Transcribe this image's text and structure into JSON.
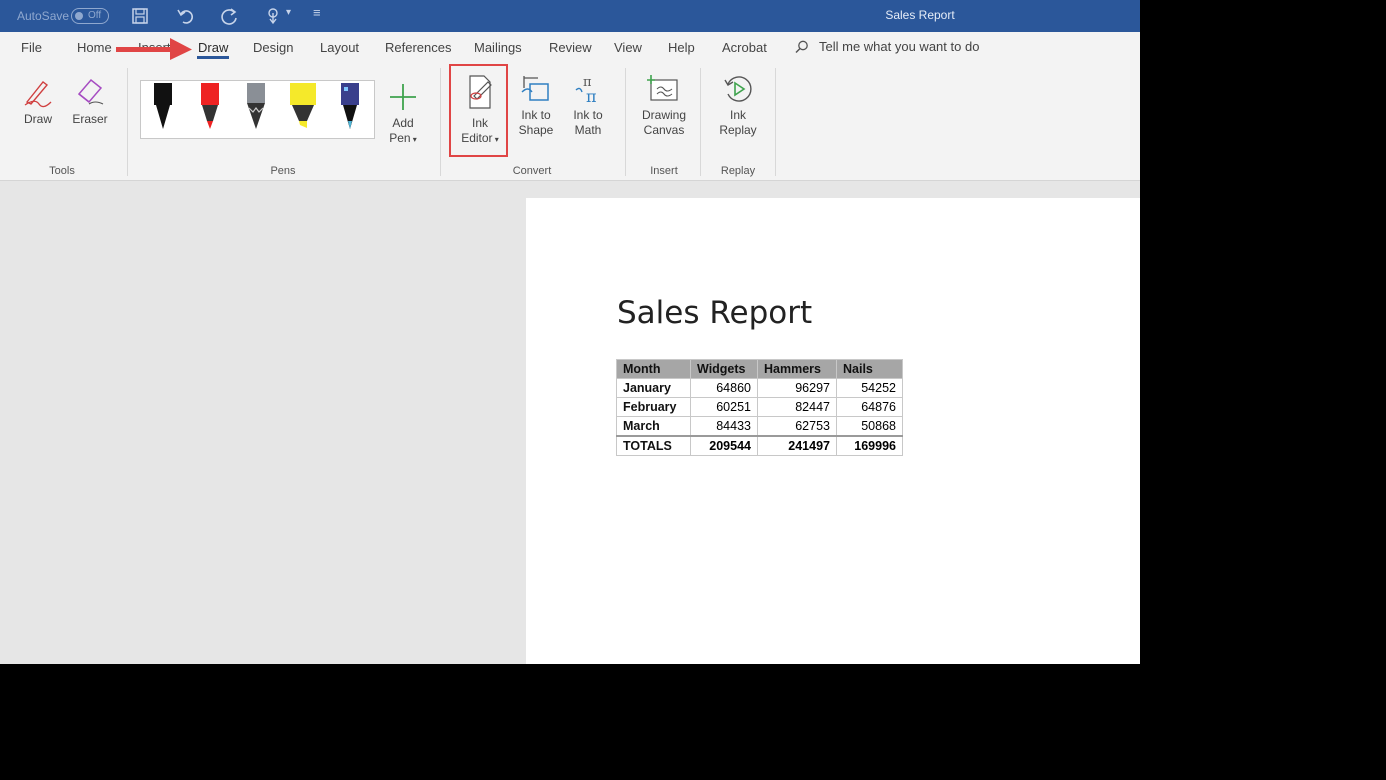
{
  "titlebar": {
    "autosave_label": "AutoSave",
    "autosave_state": "Off",
    "doc_title": "Sales Report",
    "icons": [
      "save-icon",
      "undo-icon",
      "redo-icon",
      "touch-mode-icon",
      "customize-qat-icon"
    ]
  },
  "tabs": [
    "File",
    "Home",
    "Insert",
    "Draw",
    "Design",
    "Layout",
    "References",
    "Mailings",
    "Review",
    "View",
    "Help",
    "Acrobat"
  ],
  "active_tab": "Draw",
  "tellme": {
    "label": "Tell me what you want to do"
  },
  "ribbon": {
    "tools": {
      "group_label": "Tools",
      "draw": "Draw",
      "eraser": "Eraser"
    },
    "pens": {
      "group_label": "Pens",
      "add_pen_line1": "Add",
      "add_pen_line2": "Pen"
    },
    "convert": {
      "group_label": "Convert",
      "ink_editor_line1": "Ink",
      "ink_editor_line2": "Editor",
      "ink_to_shape_line1": "Ink to",
      "ink_to_shape_line2": "Shape",
      "ink_to_math_line1": "Ink to",
      "ink_to_math_line2": "Math"
    },
    "insert": {
      "group_label": "Insert",
      "drawing_canvas_line1": "Drawing",
      "drawing_canvas_line2": "Canvas"
    },
    "replay": {
      "group_label": "Replay",
      "ink_replay_line1": "Ink",
      "ink_replay_line2": "Replay"
    }
  },
  "colors": {
    "accent": "#2b579a",
    "highlight": "#e04545"
  },
  "document": {
    "heading": "Sales Report",
    "table": {
      "headers": [
        "Month",
        "Widgets",
        "Hammers",
        "Nails"
      ],
      "rows": [
        [
          "January",
          "64860",
          "96297",
          "54252"
        ],
        [
          "February",
          "60251",
          "82447",
          "64876"
        ],
        [
          "March",
          "84433",
          "62753",
          "50868"
        ]
      ],
      "totals": [
        "TOTALS",
        "209544",
        "241497",
        "169996"
      ]
    }
  }
}
